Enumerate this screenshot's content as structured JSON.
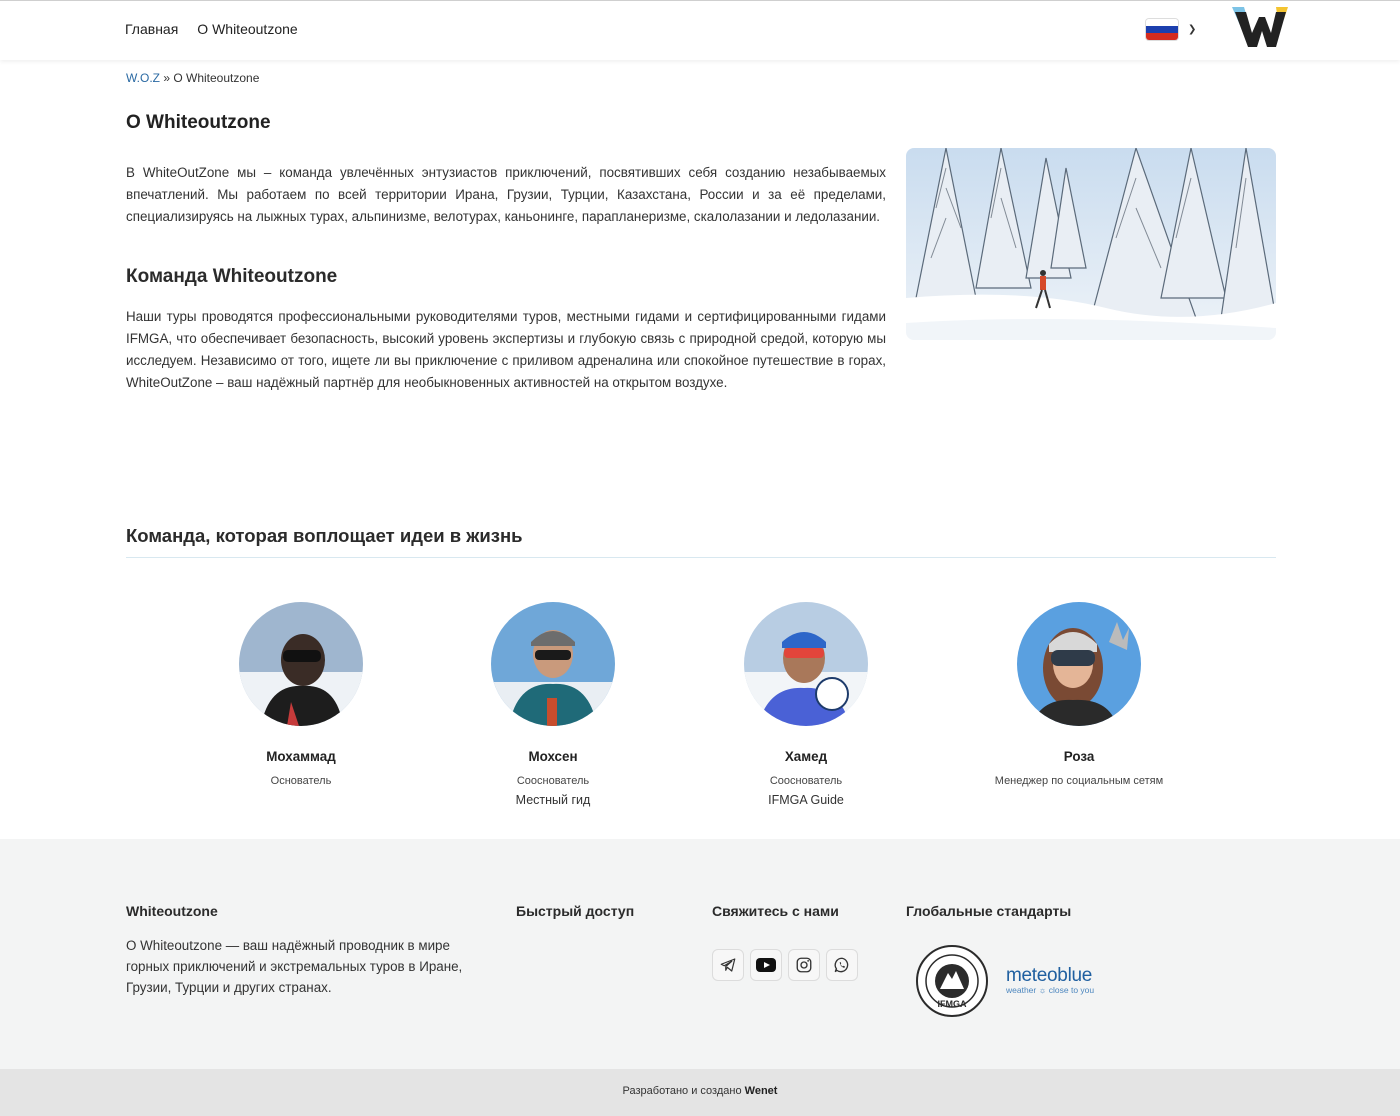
{
  "nav": {
    "items": [
      "Главная",
      "О Whiteoutzone"
    ]
  },
  "language": {
    "flag_colors": [
      "#ffffff",
      "#1c3fae",
      "#d52b1e"
    ]
  },
  "breadcrumb": {
    "root": "W.O.Z",
    "separator": " » ",
    "current": "О Whiteoutzone"
  },
  "page": {
    "title": "О Whiteoutzone",
    "intro": "В WhiteOutZone мы – команда увлечённых энтузиастов приключений, посвятивших себя созданию незабываемых впечатлений. Мы работаем по всей территории Ирана, Грузии, Турции, Казахстана, России и за её пределами, специализируясь на лыжных турах, альпинизме, велотурах, каньонинге, парапланеризме, скалолазании и ледолазании.",
    "team_heading": "Команда Whiteoutzone",
    "team_text": "Наши туры проводятся профессиональными руководителями туров, местными гидами и сертифицированными гидами IFMGA, что обеспечивает безопасность, высокий уровень экспертизы и глубокую связь с природной средой, которую мы исследуем. Независимо от того, ищете ли вы приключение с приливом адреналина или спокойное путешествие в горах, WhiteOutZone – ваш надёжный партнёр для необыкновенных активностей на открытом воздухе."
  },
  "team": {
    "title": "Команда, которая воплощает идеи в жизнь",
    "members": [
      {
        "name": "Мохаммад",
        "role": "Основатель",
        "extra": ""
      },
      {
        "name": "Мохсен",
        "role": "Сооснователь",
        "extra": "Местный гид"
      },
      {
        "name": "Хамед",
        "role": "Сооснователь",
        "extra": "IFMGA Guide"
      },
      {
        "name": "Роза",
        "role": "Менеджер по социальным сетям",
        "extra": ""
      }
    ]
  },
  "footer": {
    "about_title": "Whiteoutzone",
    "about_text": "О Whiteoutzone — ваш надёжный проводник в мире горных приключений и экстремальных туров в Иране, Грузии, Турции и других странах.",
    "quick_title": "Быстрый доступ",
    "contact_title": "Свяжитесь с нами",
    "standards_title": "Глобальные стандарты",
    "socials": [
      "telegram-icon",
      "youtube-icon",
      "instagram-icon",
      "whatsapp-icon"
    ],
    "badge_text": "IFMGA",
    "meteo_title": "meteoblue",
    "meteo_sub": "weather ☼ close to you",
    "credit_prefix": "Разработано и создано ",
    "credit_brand": "Wenet"
  }
}
